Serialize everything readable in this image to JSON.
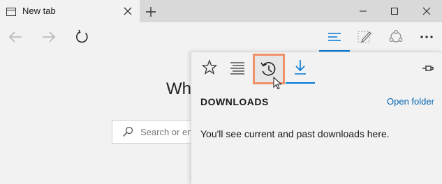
{
  "tab": {
    "title": "New tab",
    "icon": "browser-page-icon",
    "close_icon": "close-icon"
  },
  "newtab": {
    "icon": "plus-icon"
  },
  "window_controls": [
    "minimize-icon",
    "maximize-icon",
    "close-icon"
  ],
  "navbar": {
    "back_icon": "arrow-left-icon",
    "forward_icon": "arrow-right-icon",
    "refresh_icon": "refresh-icon",
    "hub_icon": "hub-icon",
    "note_icon": "web-note-icon",
    "share_icon": "share-icon",
    "more_icon": "more-icon"
  },
  "page": {
    "heading": "Wh",
    "search_placeholder": "Search or en"
  },
  "hub": {
    "tabs": [
      {
        "icon": "star-icon",
        "name": "Favorites"
      },
      {
        "icon": "reading-list-icon",
        "name": "Reading list"
      },
      {
        "icon": "history-icon",
        "name": "History"
      },
      {
        "icon": "download-icon",
        "name": "Downloads"
      }
    ],
    "active_tab": "Downloads",
    "highlighted_tab": "History",
    "pin_icon": "pin-icon",
    "title": "DOWNLOADS",
    "open_folder": "Open folder",
    "message": "You'll see current and past downloads here."
  },
  "colors": {
    "accent": "#0078d7",
    "highlight_border": "#f0916a",
    "link": "#0063b1"
  }
}
